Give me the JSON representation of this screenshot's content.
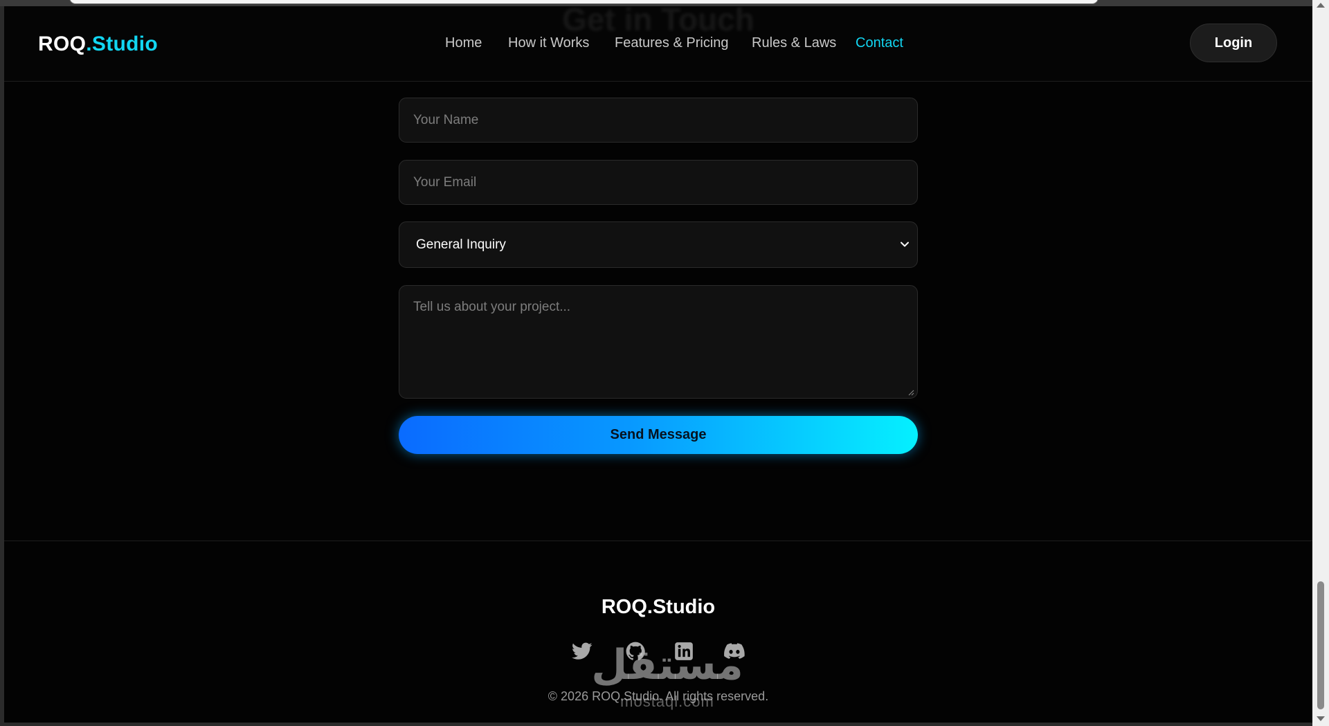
{
  "header": {
    "ghost_title": "Get in Touch",
    "logo_main": "ROQ",
    "logo_accent": ".Studio",
    "nav": [
      {
        "label": "Home"
      },
      {
        "label": "How it Works"
      },
      {
        "label": "Features & Pricing"
      },
      {
        "label": "Rules & Laws"
      },
      {
        "label": "Contact",
        "active": true
      }
    ],
    "login_label": "Login"
  },
  "form": {
    "name_placeholder": "Your Name",
    "email_placeholder": "Your Email",
    "subject_selected": "General Inquiry",
    "message_placeholder": "Tell us about your project...",
    "submit_label": "Send Message"
  },
  "footer": {
    "logo": "ROQ.Studio",
    "social": [
      {
        "icon": "twitter-icon"
      },
      {
        "icon": "github-icon"
      },
      {
        "icon": "linkedin-icon"
      },
      {
        "icon": "discord-icon"
      }
    ],
    "copyright": "© 2026 ROQ.Studio. All rights reserved."
  },
  "watermark": {
    "arabic": "مستقل",
    "latin": "mostaql.com"
  },
  "colors": {
    "accent": "#12d6f2",
    "background": "#030303",
    "button_gradient_start": "#0a6bff",
    "button_gradient_end": "#05f0ff"
  }
}
